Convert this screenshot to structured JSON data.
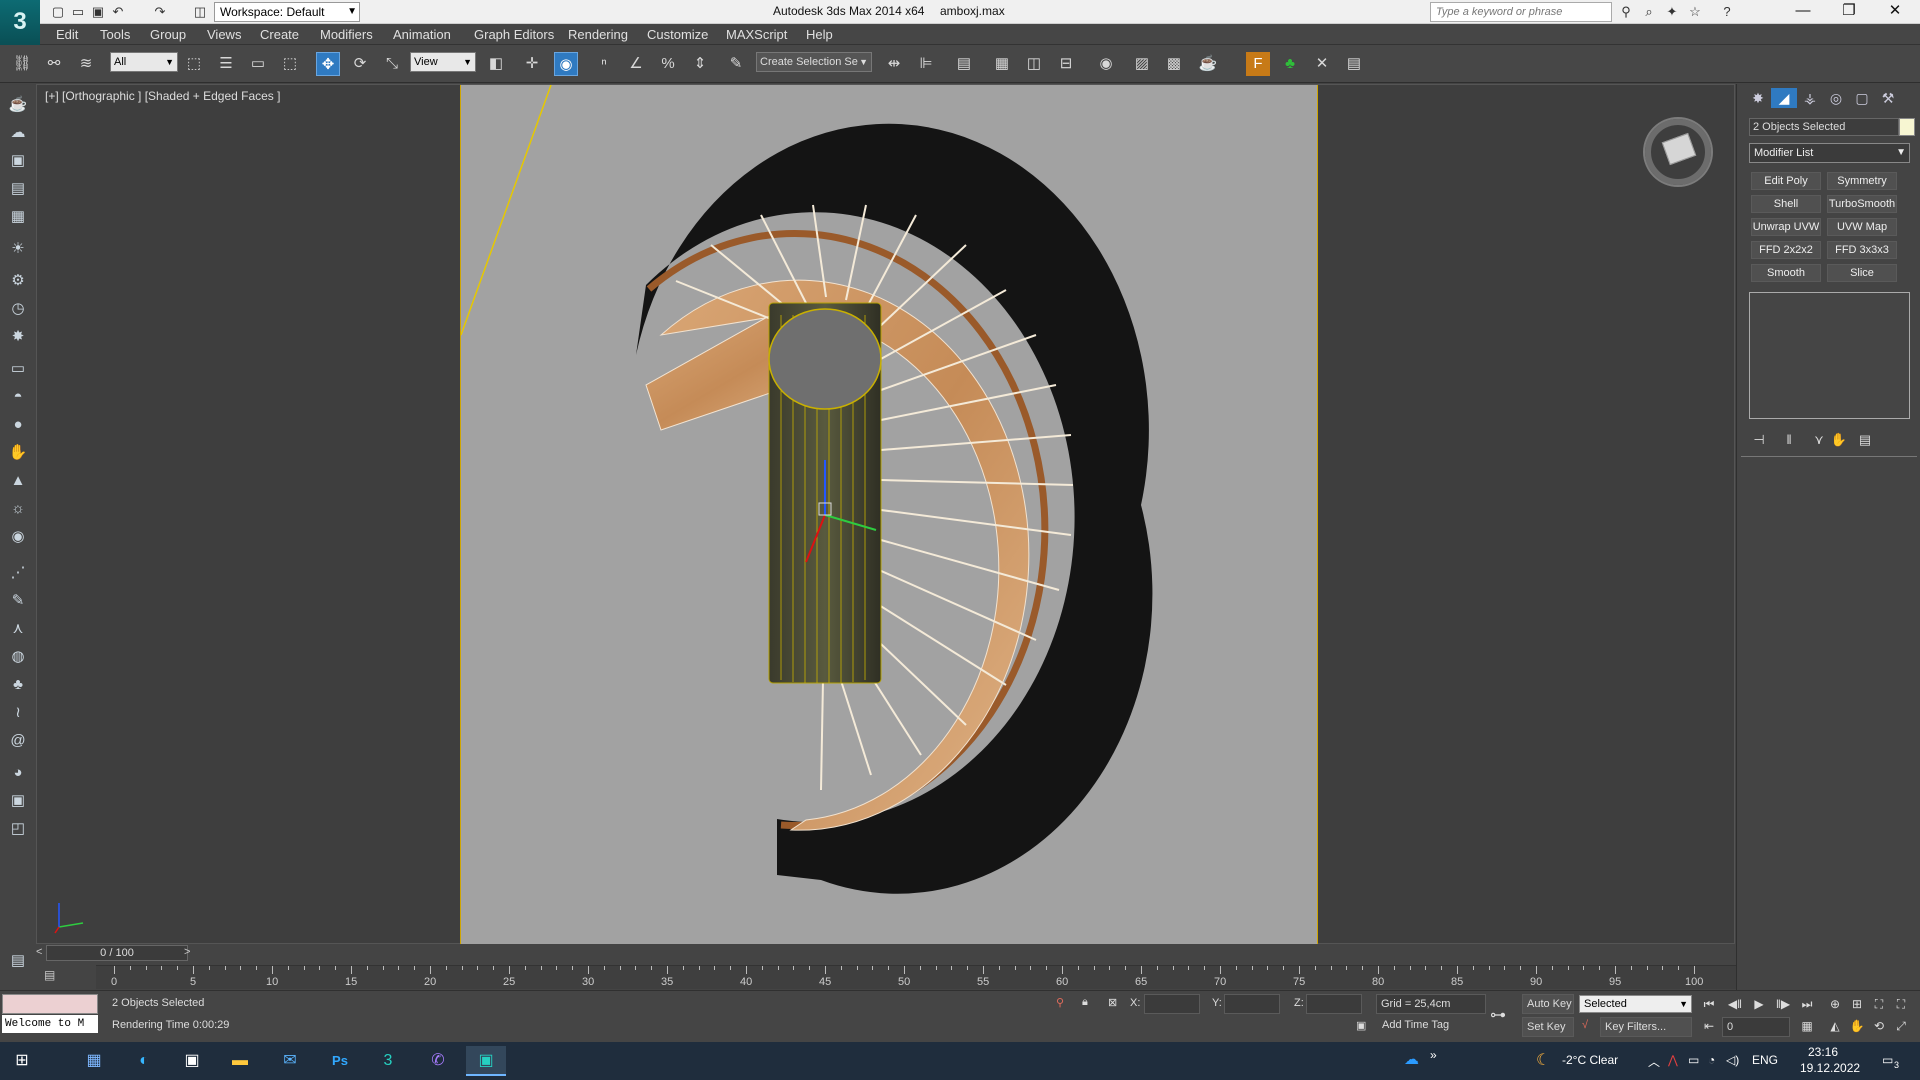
{
  "titlebar": {
    "workspace": "Workspace: Default",
    "app": "Autodesk 3ds Max  2014 x64",
    "file": "amboxj.max",
    "search_placeholder": "Type a keyword or phrase"
  },
  "menus": [
    "Edit",
    "Tools",
    "Group",
    "Views",
    "Create",
    "Modifiers",
    "Animation",
    "Graph Editors",
    "Rendering",
    "Customize",
    "MAXScript",
    "Help"
  ],
  "toolbar": {
    "filter": "All",
    "refcoord": "View",
    "selection_set": "Create Selection Se"
  },
  "viewport": {
    "label": "[+] [Orthographic ] [Shaded + Edged Faces ]"
  },
  "command_panel": {
    "selection": "2 Objects Selected",
    "modifier_list": "Modifier List",
    "modifiers": [
      "Edit Poly",
      "Symmetry",
      "Shell",
      "TurboSmooth",
      "Unwrap UVW",
      "UVW Map",
      "FFD 2x2x2",
      "FFD 3x3x3",
      "Smooth",
      "Slice"
    ]
  },
  "timeline": {
    "frame": "0 / 100",
    "ticks": [
      "0",
      "5",
      "10",
      "15",
      "20",
      "25",
      "30",
      "35",
      "40",
      "45",
      "50",
      "55",
      "60",
      "65",
      "70",
      "75",
      "80",
      "85",
      "90",
      "95",
      "100"
    ]
  },
  "status": {
    "welcome": "Welcome to M",
    "selected": "2 Objects Selected",
    "render_time": "Rendering Time  0:00:29",
    "x": "X:",
    "y": "Y:",
    "z": "Z:",
    "grid": "Grid = 25,4cm",
    "add_time_tag": "Add Time Tag",
    "auto_key": "Auto Key",
    "set_key": "Set Key",
    "key_mode": "Selected",
    "key_filters": "Key Filters...",
    "frame_field": "0"
  },
  "taskbar": {
    "weather": "-2°C  Clear",
    "lang": "ENG",
    "time": "23:16",
    "date": "19.12.2022",
    "notif": "3"
  },
  "colors": {
    "accent": "#2f7ac1",
    "viewport_bg": "#a2a2a2",
    "frame": "#cfa500",
    "wood": "#c98f5d"
  }
}
